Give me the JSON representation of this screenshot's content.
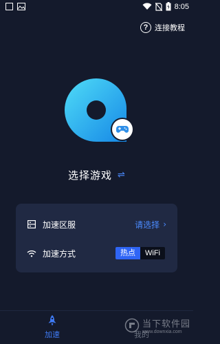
{
  "status_bar": {
    "time": "8:05"
  },
  "header": {
    "help_label": "连接教程",
    "help_symbol": "?"
  },
  "game": {
    "select_label": "选择游戏",
    "swap_symbol": "⇌"
  },
  "settings": {
    "region": {
      "label": "加速区服",
      "value": "请选择",
      "chevron": "›"
    },
    "mode": {
      "label": "加速方式",
      "options": [
        "热点",
        "WiFi"
      ],
      "selected": "热点"
    }
  },
  "bottom_nav": {
    "tabs": [
      {
        "label": "加速",
        "active": true
      },
      {
        "label": "我的",
        "active": false
      }
    ]
  },
  "watermark": {
    "main": "当下软件园",
    "sub": "www.downxia.com"
  },
  "colors": {
    "background": "#141a2c",
    "card": "#202943",
    "accent": "#3f7bf5",
    "logo_gradient_start": "#3fd2f5",
    "logo_gradient_end": "#1a8fe8"
  }
}
